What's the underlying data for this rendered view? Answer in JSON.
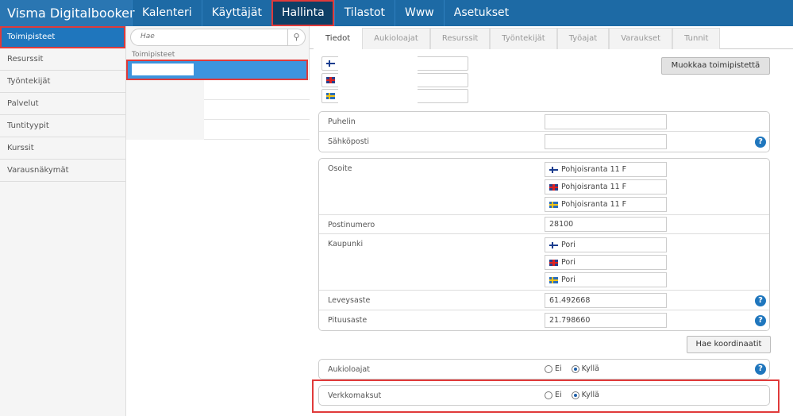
{
  "app": {
    "brand": "Visma Digitalbooker"
  },
  "nav": [
    {
      "label": "Kalenteri"
    },
    {
      "label": "Käyttäjät"
    },
    {
      "label": "Hallinta"
    },
    {
      "label": "Tilastot"
    },
    {
      "label": "Www"
    },
    {
      "label": "Asetukset"
    }
  ],
  "sidebar": {
    "items": [
      {
        "label": "Toimipisteet"
      },
      {
        "label": "Resurssit"
      },
      {
        "label": "Työntekijät"
      },
      {
        "label": "Palvelut"
      },
      {
        "label": "Tuntityypit"
      },
      {
        "label": "Kurssit"
      },
      {
        "label": "Varausnäkymät"
      }
    ]
  },
  "middle": {
    "search_placeholder": "Hae",
    "list_label": "Toimipisteet"
  },
  "tabs": [
    {
      "label": "Tiedot"
    },
    {
      "label": "Aukioloajat"
    },
    {
      "label": "Resurssit"
    },
    {
      "label": "Työntekijät"
    },
    {
      "label": "Työajat"
    },
    {
      "label": "Varaukset"
    },
    {
      "label": "Tunnit"
    }
  ],
  "form": {
    "edit_button": "Muokkaa toimipistettä",
    "phone_label": "Puhelin",
    "email_label": "Sähköposti",
    "address_label": "Osoite",
    "address": {
      "fi": "Pohjoisranta 11 F",
      "en": "Pohjoisranta 11 F",
      "sv": "Pohjoisranta 11 F"
    },
    "postal_label": "Postinumero",
    "postal": "28100",
    "city_label": "Kaupunki",
    "city": {
      "fi": "Pori",
      "en": "Pori",
      "sv": "Pori"
    },
    "lat_label": "Leveysaste",
    "lat": "61.492668",
    "lon_label": "Pituusaste",
    "lon": "21.798660",
    "coords_button": "Hae koordinaatit",
    "opening_label": "Aukioloajat",
    "payments_label": "Verkkomaksut",
    "no": "Ei",
    "yes": "Kyllä",
    "help": "?"
  }
}
